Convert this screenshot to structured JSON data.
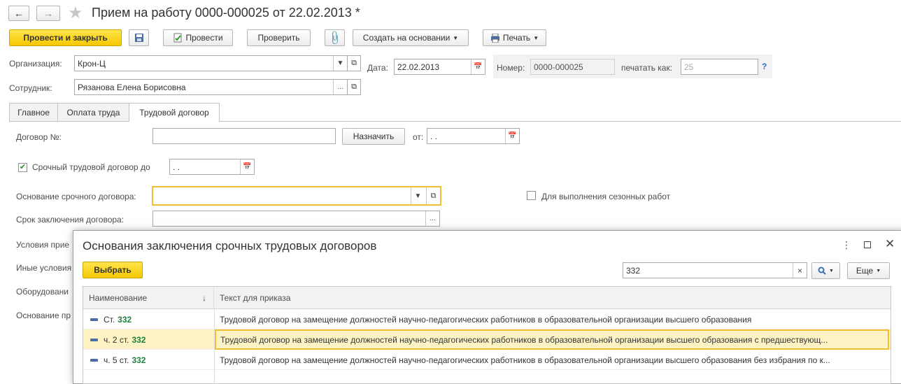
{
  "window": {
    "title": "Прием на работу 0000-000025 от 22.02.2013 *"
  },
  "toolbar": {
    "post_close": "Провести и закрыть",
    "post": "Провести",
    "check": "Проверить",
    "create_based": "Создать на основании",
    "print": "Печать"
  },
  "header": {
    "org_label": "Организация:",
    "org_value": "Крон-Ц",
    "date_label": "Дата:",
    "date_value": "22.02.2013",
    "number_label": "Номер:",
    "number_value": "0000-000025",
    "print_as_label": "печатать как:",
    "print_as_placeholder": "25",
    "help": "?",
    "employee_label": "Сотрудник:",
    "employee_value": "Рязанова Елена Борисовна"
  },
  "tabs": [
    "Главное",
    "Оплата труда",
    "Трудовой договор"
  ],
  "contract": {
    "number_label": "Договор №:",
    "number_value": "",
    "assign": "Назначить",
    "from_label": "от:",
    "from_value": " .  .",
    "fixed_term_label": "Срочный трудовой договор до",
    "fixed_term_value": " .  .",
    "basis_label": "Основание срочного договора:",
    "basis_value": "",
    "seasonal_label": "Для выполнения сезонных работ",
    "term_label": "Срок заключения договора:",
    "conditions_label": "Условия прие",
    "other_label": "Иные условия",
    "equipment_label": "Оборудовани",
    "order_basis_label": "Основание пр"
  },
  "modal": {
    "title": "Основания заключения срочных трудовых договоров",
    "select": "Выбрать",
    "search_value": "332",
    "more": "Еще",
    "col_name": "Наименование",
    "col_text": "Текст для приказа",
    "rows": [
      {
        "name_prefix": "Ст.",
        "name_number": "332",
        "text": "Трудовой договор на замещение должностей научно-педагогических работников в образовательной организации высшего образования"
      },
      {
        "name_prefix": "ч. 2 ст.",
        "name_number": "332",
        "text": "Трудовой договор на замещение должностей научно-педагогических работников в образовательной организации высшего образования с предшествующ..."
      },
      {
        "name_prefix": "ч. 5 ст.",
        "name_number": "332",
        "text": "Трудовой договор на замещение должностей научно-педагогических работников в образовательной организации высшего образования без избрания по к..."
      }
    ]
  },
  "colors": {
    "accent_yellow": "#f6c800",
    "focus_border": "#f0c030",
    "selected_row": "#fdf3c4",
    "number_green": "#1f7f3f"
  }
}
